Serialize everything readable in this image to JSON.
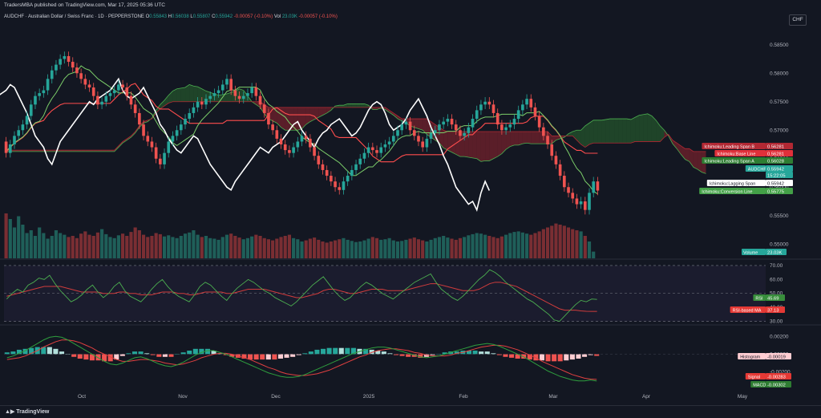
{
  "header": {
    "published": "TradersMBA published on TradingView.com, Mar 17, 2025 05:36 UTC",
    "symbol": "AUDCHF · Australian Dollar / Swiss Franc · 1D · PEPPERSTONE",
    "ohlc": [
      {
        "k": "O",
        "v": "0.55843"
      },
      {
        "k": "H",
        "v": "0.56038"
      },
      {
        "k": "L",
        "v": "0.55807"
      },
      {
        "k": "C",
        "v": "0.55942"
      },
      {
        "k": "",
        "v": "-0.00057 (-0.10%)"
      }
    ],
    "vol_label": "Vol",
    "vol_value": "23.03K",
    "vol_change": "-0.00057 (-0.10%)",
    "currency": "CHF"
  },
  "footer": {
    "brand": "TradingView"
  },
  "colors": {
    "bg": "#131722",
    "up": "#26a69a",
    "down": "#ef5350",
    "ema": "#ffffff",
    "base": "#ff4d4d",
    "conv": "#7ccf6a",
    "rsi": "#3c8c3c",
    "rsima": "#d03c3c",
    "macd": "#2e9e3e",
    "signal": "#e04040"
  },
  "chart_data": [
    {
      "type": "candlestick",
      "title": "AUDCHF · Australian Dollar / Swiss Franc · 1D · PEPPERSTONE",
      "xlabels": [
        "Oct",
        "Nov",
        "Dec",
        "2025",
        "Feb",
        "Mar",
        "Apr",
        "May"
      ],
      "yticks": [
        "0.58500",
        "0.58000",
        "0.57500",
        "0.57000",
        "0.56500",
        "0.56000",
        "0.55500",
        "0.55000"
      ],
      "ylim": [
        0.5475,
        0.5875
      ],
      "close_start": 0.568,
      "closes": [
        0.566,
        0.5675,
        0.569,
        0.57,
        0.571,
        0.5725,
        0.5745,
        0.576,
        0.5765,
        0.577,
        0.579,
        0.5805,
        0.5815,
        0.5825,
        0.583,
        0.582,
        0.581,
        0.58,
        0.579,
        0.578,
        0.5775,
        0.576,
        0.5745,
        0.575,
        0.576,
        0.5765,
        0.577,
        0.578,
        0.5775,
        0.576,
        0.5745,
        0.573,
        0.571,
        0.569,
        0.568,
        0.567,
        0.565,
        0.564,
        0.566,
        0.568,
        0.569,
        0.57,
        0.571,
        0.572,
        0.573,
        0.574,
        0.575,
        0.5745,
        0.5755,
        0.576,
        0.5765,
        0.577,
        0.578,
        0.579,
        0.577,
        0.576,
        0.5755,
        0.576,
        0.5765,
        0.5775,
        0.576,
        0.5745,
        0.573,
        0.571,
        0.57,
        0.5685,
        0.5675,
        0.5665,
        0.566,
        0.567,
        0.568,
        0.569,
        0.5685,
        0.567,
        0.5655,
        0.564,
        0.563,
        0.562,
        0.561,
        0.56,
        0.5595,
        0.561,
        0.562,
        0.563,
        0.564,
        0.565,
        0.566,
        0.567,
        0.5665,
        0.566,
        0.567,
        0.5675,
        0.568,
        0.569,
        0.57,
        0.571,
        0.5715,
        0.57,
        0.569,
        0.568,
        0.567,
        0.5685,
        0.5695,
        0.57,
        0.571,
        0.5715,
        0.572,
        0.571,
        0.57,
        0.569,
        0.5695,
        0.5705,
        0.572,
        0.5735,
        0.5745,
        0.575,
        0.5745,
        0.573,
        0.571,
        0.57,
        0.5705,
        0.571,
        0.572,
        0.5735,
        0.5745,
        0.5755,
        0.574,
        0.5725,
        0.5705,
        0.569,
        0.5675,
        0.5655,
        0.564,
        0.562,
        0.56,
        0.559,
        0.558,
        0.557,
        0.5575,
        0.556,
        0.559,
        0.561,
        0.5594
      ],
      "ohlc_last": {
        "o": 0.55843,
        "h": 0.56038,
        "l": 0.55807,
        "c": 0.55942
      },
      "volume": [
        0.8,
        0.7,
        0.55,
        0.75,
        0.6,
        0.45,
        0.5,
        0.4,
        0.55,
        0.45,
        0.35,
        0.4,
        0.5,
        0.45,
        0.42,
        0.38,
        0.4,
        0.36,
        0.44,
        0.48,
        0.42,
        0.4,
        0.46,
        0.52,
        0.43,
        0.38,
        0.36,
        0.41,
        0.44,
        0.4,
        0.47,
        0.55,
        0.5,
        0.42,
        0.38,
        0.4,
        0.45,
        0.43,
        0.39,
        0.41,
        0.38,
        0.36,
        0.4,
        0.44,
        0.46,
        0.5,
        0.42,
        0.38,
        0.4,
        0.36,
        0.35,
        0.33,
        0.38,
        0.42,
        0.44,
        0.4,
        0.37,
        0.34,
        0.36,
        0.39,
        0.42,
        0.4,
        0.36,
        0.34,
        0.32,
        0.35,
        0.38,
        0.4,
        0.42,
        0.36,
        0.34,
        0.3,
        0.32,
        0.35,
        0.37,
        0.33,
        0.3,
        0.28,
        0.3,
        0.32,
        0.34,
        0.36,
        0.33,
        0.31,
        0.29,
        0.3,
        0.32,
        0.35,
        0.38,
        0.36,
        0.33,
        0.34,
        0.36,
        0.32,
        0.3,
        0.31,
        0.33,
        0.35,
        0.37,
        0.34,
        0.32,
        0.3,
        0.33,
        0.36,
        0.38,
        0.4,
        0.37,
        0.35,
        0.33,
        0.36,
        0.38,
        0.41,
        0.43,
        0.45,
        0.44,
        0.42,
        0.4,
        0.38,
        0.36,
        0.39,
        0.42,
        0.45,
        0.47,
        0.48,
        0.46,
        0.44,
        0.42,
        0.45,
        0.48,
        0.52,
        0.55,
        0.58,
        0.62,
        0.6,
        0.58,
        0.55,
        0.52,
        0.5,
        0.48,
        0.4,
        0.3,
        0.12
      ],
      "price_labels": [
        {
          "text": "Ichimoku:Leading Span B",
          "value": "0.56281",
          "bg": "#b22833",
          "fg": "#ffffff"
        },
        {
          "text": "Ichimoku:Base Line",
          "value": "0.56281",
          "bg": "#e0303a",
          "fg": "#ffffff"
        },
        {
          "text": "Ichimoku:Leading Span A",
          "value": "0.56028",
          "bg": "#2e7d32",
          "fg": "#ffffff"
        },
        {
          "text": "AUDCHF",
          "value": "0.55942",
          "bg": "#26a69a",
          "fg": "#ffffff"
        },
        {
          "text": "",
          "value": "15:22:05",
          "bg": "#26a69a",
          "fg": "#ffffff"
        },
        {
          "text": "Ichimoku:Lagging Span",
          "value": "0.55942",
          "bg": "#ffffff",
          "fg": "#131722"
        },
        {
          "text": "Ichimoku:Conversion Line",
          "value": "0.55775",
          "bg": "#43a047",
          "fg": "#ffffff"
        }
      ],
      "volume_label": {
        "text": "Volume",
        "value": "23.03K"
      }
    },
    {
      "type": "line",
      "name": "RSI",
      "yticks": [
        "70.00",
        "60.00",
        "50.00",
        "40.00",
        "30.00"
      ],
      "ylim": [
        28,
        74
      ],
      "series": [
        {
          "name": "RSI",
          "values": [
            46,
            50,
            53,
            51,
            56,
            58,
            61,
            60,
            63,
            57,
            52,
            48,
            44,
            46,
            49,
            53,
            56,
            51,
            47,
            50,
            55,
            58,
            52,
            48,
            46,
            44,
            48,
            53,
            57,
            60,
            55,
            51,
            48,
            46,
            44,
            49,
            55,
            58,
            56,
            52,
            48,
            45,
            50,
            54,
            57,
            60,
            58,
            55,
            52,
            50,
            47,
            45,
            43,
            41,
            44,
            48,
            52,
            56,
            59,
            62,
            57,
            52,
            48,
            45,
            47,
            51,
            55,
            58,
            56,
            53,
            50,
            48,
            46,
            49,
            52,
            55,
            58,
            60,
            62,
            64,
            58,
            53,
            50,
            47,
            45,
            48,
            52,
            56,
            60,
            63,
            67,
            65,
            62,
            58,
            55,
            52,
            49,
            46,
            44,
            41,
            38,
            35,
            31,
            30,
            34,
            38,
            42,
            45,
            44,
            46,
            45.69
          ]
        },
        {
          "name": "RSI-based MA",
          "values": [
            48,
            49,
            50,
            51,
            52,
            53,
            54,
            55,
            55,
            55,
            55,
            54,
            53,
            52,
            51,
            51,
            51,
            51,
            50,
            50,
            50,
            51,
            51,
            50,
            50,
            49,
            49,
            49,
            50,
            51,
            51,
            51,
            50,
            50,
            49,
            49,
            50,
            51,
            51,
            51,
            51,
            50,
            50,
            51,
            52,
            53,
            53,
            53,
            53,
            52,
            51,
            50,
            49,
            48,
            47,
            47,
            48,
            49,
            50,
            52,
            53,
            53,
            52,
            51,
            50,
            50,
            51,
            52,
            53,
            53,
            53,
            52,
            52,
            52,
            52,
            53,
            54,
            55,
            56,
            57,
            57,
            56,
            55,
            54,
            53,
            52,
            52,
            52,
            53,
            55,
            57,
            58,
            58,
            57,
            56,
            55,
            53,
            51,
            49,
            47,
            45,
            43,
            41,
            39,
            38,
            38,
            38,
            37.5,
            37.2,
            37.1,
            37.13
          ]
        }
      ],
      "labels": [
        {
          "text": "RSI",
          "value": "45.69",
          "bg": "#388e3c"
        },
        {
          "text": "RSI-based MA",
          "value": "37.13",
          "bg": "#e53935"
        }
      ]
    },
    {
      "type": "line",
      "name": "MACD",
      "yticks": [
        "0.00200",
        "0.00000",
        "-0.00200"
      ],
      "ylim": [
        -0.0042,
        0.0032
      ],
      "series": [
        {
          "name": "MACD",
          "values": [
            -0.0004,
            -0.0002,
            0.0001,
            0.0004,
            0.0008,
            0.0012,
            0.0016,
            0.0019,
            0.002,
            0.0019,
            0.0016,
            0.0012,
            0.0008,
            0.0004,
            0.0,
            -0.0004,
            -0.0008,
            -0.0011,
            -0.0012,
            -0.001,
            -0.0007,
            -0.0004,
            -0.0003,
            -0.0005,
            -0.0008,
            -0.0011,
            -0.0013,
            -0.0014,
            -0.0012,
            -0.0009,
            -0.0005,
            -0.0001,
            0.0002,
            0.0004,
            0.0004,
            0.0002,
            0.0,
            -0.0003,
            -0.0006,
            -0.0009,
            -0.0012,
            -0.0015,
            -0.0018,
            -0.0021,
            -0.0023,
            -0.0025,
            -0.0026,
            -0.0026,
            -0.0025,
            -0.0023,
            -0.002,
            -0.0017,
            -0.0014,
            -0.0011,
            -0.0008,
            -0.0005,
            -0.0002,
            0.0001,
            0.0003,
            0.0005,
            0.0007,
            0.0008,
            0.0008,
            0.0007,
            0.0005,
            0.0003,
            0.0001,
            -0.0001,
            -0.0003,
            -0.0004,
            -0.0003,
            -0.0002,
            0.0,
            0.0002,
            0.0004,
            0.0006,
            0.0008,
            0.001,
            0.0011,
            0.0012,
            0.0011,
            0.0009,
            0.0006,
            0.0003,
            0.0,
            -0.0003,
            -0.0007,
            -0.0011,
            -0.0015,
            -0.0019,
            -0.0022,
            -0.0025,
            -0.0027,
            -0.0029,
            -0.003,
            -0.003,
            -0.0029,
            -0.00302
          ]
        },
        {
          "name": "Signal",
          "values": [
            -0.0006,
            -0.0005,
            -0.0004,
            -0.0002,
            0.0001,
            0.0004,
            0.0008,
            0.0011,
            0.0014,
            0.0016,
            0.0016,
            0.0015,
            0.0013,
            0.001,
            0.0007,
            0.0003,
            0.0,
            -0.0003,
            -0.0006,
            -0.0008,
            -0.0008,
            -0.0007,
            -0.0006,
            -0.0006,
            -0.0007,
            -0.0008,
            -0.001,
            -0.0011,
            -0.0012,
            -0.0011,
            -0.0009,
            -0.0007,
            -0.0004,
            -0.0002,
            0.0,
            0.0001,
            0.0001,
            0.0,
            -0.0002,
            -0.0004,
            -0.0006,
            -0.0009,
            -0.0012,
            -0.0015,
            -0.0017,
            -0.002,
            -0.0022,
            -0.0023,
            -0.0024,
            -0.0024,
            -0.0023,
            -0.0022,
            -0.002,
            -0.0018,
            -0.0015,
            -0.0012,
            -0.0009,
            -0.0006,
            -0.0003,
            -0.0001,
            0.0002,
            0.0004,
            0.0005,
            0.0006,
            0.0006,
            0.0005,
            0.0004,
            0.0002,
            0.0001,
            -0.0001,
            -0.0002,
            -0.0002,
            -0.0002,
            -0.0001,
            0.0001,
            0.0002,
            0.0004,
            0.0006,
            0.0008,
            0.0009,
            0.001,
            0.001,
            0.0009,
            0.0007,
            0.0005,
            0.0002,
            -0.0001,
            -0.0004,
            -0.0008,
            -0.0011,
            -0.0014,
            -0.0017,
            -0.002,
            -0.0023,
            -0.0025,
            -0.0027,
            -0.0028,
            -0.00283
          ]
        }
      ],
      "labels": [
        {
          "text": "Histogram",
          "value": "-0.00019",
          "bg": "#ffcdd2",
          "fg": "#131722"
        },
        {
          "text": "Signal",
          "value": "-0.00283",
          "bg": "#e53935",
          "fg": "#ffffff"
        },
        {
          "text": "MACD",
          "value": "-0.00302",
          "bg": "#2e7d32",
          "fg": "#ffffff"
        }
      ]
    }
  ]
}
